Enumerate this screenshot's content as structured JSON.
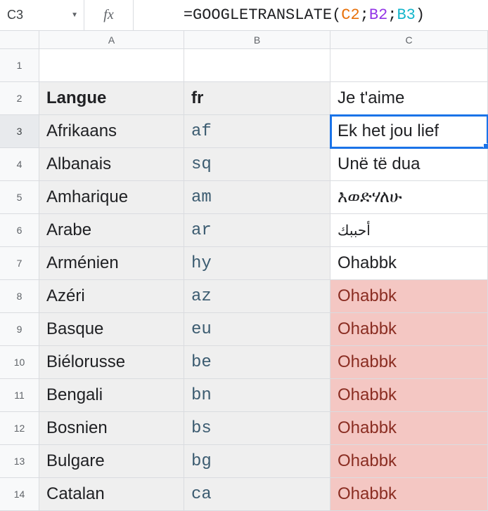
{
  "nameBox": "C3",
  "fxLabel": "fx",
  "formula": {
    "eq": "=",
    "fn": "GOOGLETRANSLATE",
    "open": "(",
    "ref1": "C2",
    "sep1": ";",
    "ref2": "B2",
    "sep2": ";",
    "ref3": "B3",
    "close": ")"
  },
  "columns": [
    "A",
    "B",
    "C"
  ],
  "rows": [
    {
      "n": "1",
      "A": "",
      "B": "",
      "C": "",
      "greyAB": false,
      "hdrBold": false,
      "mono": false,
      "red": false
    },
    {
      "n": "2",
      "A": "Langue",
      "B": "fr",
      "C": "Je t'aime",
      "greyAB": true,
      "hdrBold": true,
      "mono": false,
      "red": false
    },
    {
      "n": "3",
      "A": "Afrikaans",
      "B": "af",
      "C": "Ek het jou lief",
      "greyAB": true,
      "hdrBold": false,
      "mono": true,
      "red": false,
      "selected": true
    },
    {
      "n": "4",
      "A": "Albanais",
      "B": "sq",
      "C": "Unë të dua",
      "greyAB": true,
      "hdrBold": false,
      "mono": true,
      "red": false
    },
    {
      "n": "5",
      "A": "Amharique",
      "B": "am",
      "C": "እወድሃለሁ",
      "greyAB": true,
      "hdrBold": false,
      "mono": true,
      "red": false
    },
    {
      "n": "6",
      "A": "Arabe",
      "B": "ar",
      "C": "أحببك",
      "greyAB": true,
      "hdrBold": false,
      "mono": true,
      "red": false
    },
    {
      "n": "7",
      "A": "Arménien",
      "B": "hy",
      "C": "Ohabbk",
      "greyAB": true,
      "hdrBold": false,
      "mono": true,
      "red": false
    },
    {
      "n": "8",
      "A": "Azéri",
      "B": "az",
      "C": "Ohabbk",
      "greyAB": true,
      "hdrBold": false,
      "mono": true,
      "red": true
    },
    {
      "n": "9",
      "A": "Basque",
      "B": "eu",
      "C": "Ohabbk",
      "greyAB": true,
      "hdrBold": false,
      "mono": true,
      "red": true
    },
    {
      "n": "10",
      "A": "Biélorusse",
      "B": "be",
      "C": "Ohabbk",
      "greyAB": true,
      "hdrBold": false,
      "mono": true,
      "red": true
    },
    {
      "n": "11",
      "A": "Bengali",
      "B": "bn",
      "C": "Ohabbk",
      "greyAB": true,
      "hdrBold": false,
      "mono": true,
      "red": true
    },
    {
      "n": "12",
      "A": "Bosnien",
      "B": "bs",
      "C": "Ohabbk",
      "greyAB": true,
      "hdrBold": false,
      "mono": true,
      "red": true
    },
    {
      "n": "13",
      "A": "Bulgare",
      "B": "bg",
      "C": "Ohabbk",
      "greyAB": true,
      "hdrBold": false,
      "mono": true,
      "red": true
    },
    {
      "n": "14",
      "A": "Catalan",
      "B": "ca",
      "C": "Ohabbk",
      "greyAB": true,
      "hdrBold": false,
      "mono": true,
      "red": true
    }
  ]
}
